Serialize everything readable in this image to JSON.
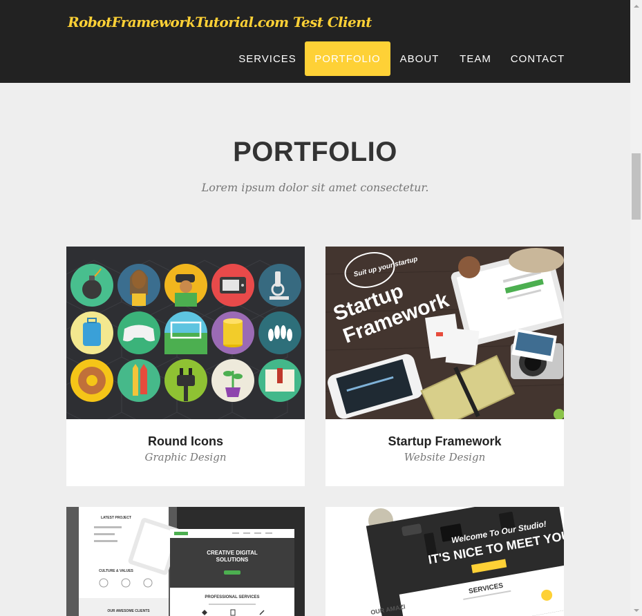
{
  "navbar": {
    "brand": "RobotFrameworkTutorial.com Test Client",
    "items": [
      {
        "label": "SERVICES",
        "active": false
      },
      {
        "label": "PORTFOLIO",
        "active": true
      },
      {
        "label": "ABOUT",
        "active": false
      },
      {
        "label": "TEAM",
        "active": false
      },
      {
        "label": "CONTACT",
        "active": false
      }
    ]
  },
  "portfolio": {
    "heading": "PORTFOLIO",
    "subheading": "Lorem ipsum dolor sit amet consectetur.",
    "items": [
      {
        "title": "Round Icons",
        "category": "Graphic Design"
      },
      {
        "title": "Startup Framework",
        "category": "Website Design"
      },
      {
        "title": "",
        "category": ""
      },
      {
        "title": "",
        "category": ""
      }
    ],
    "thumb_text": {
      "startup_badge": "Suit up your startup",
      "startup_title_1": "Startup",
      "startup_title_2": "Framework",
      "treehouse_latest": "LATEST PROJECT",
      "treehouse_culture": "CULTURE & VALUES",
      "treehouse_clients": "OUR AWESOME CLIENTS",
      "treehouse_creative_1": "CREATIVE DIGITAL",
      "treehouse_creative_2": "SOLUTIONS",
      "treehouse_services": "PROFESSIONAL SERVICES",
      "golden_welcome": "Welcome To Our Studio!",
      "golden_nice": "IT'S NICE TO MEET YOU",
      "golden_services": "SERVICES",
      "golden_amazing": "OUR AMAZI"
    }
  },
  "colors": {
    "accent": "#fed136",
    "navbar_bg": "#222222",
    "page_bg": "#eeeeee"
  }
}
